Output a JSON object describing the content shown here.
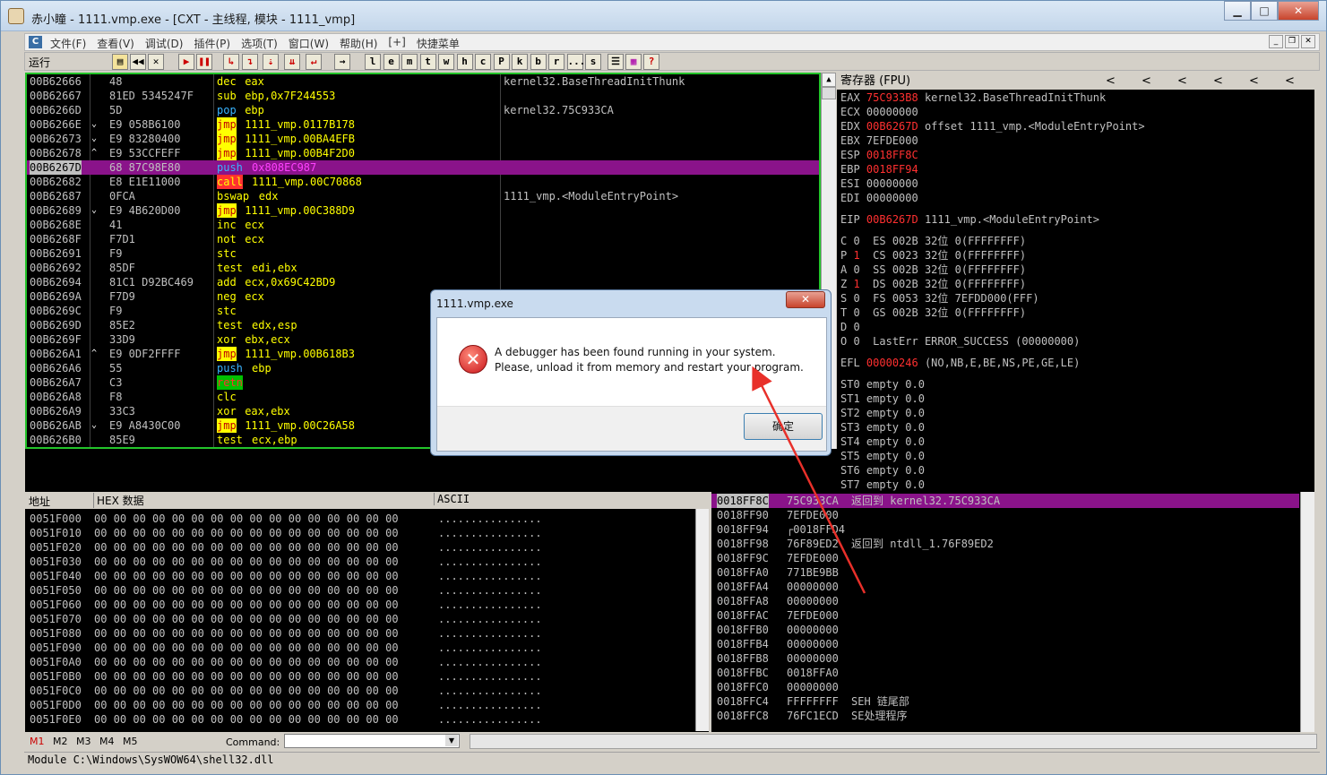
{
  "window": {
    "title": "赤小瞳 - 1111.vmp.exe - [CXT - 主线程, 模块 - 1111_vmp]",
    "min": "▁",
    "max": "□",
    "close": "✕"
  },
  "menu": {
    "logo": "C",
    "items": [
      "文件(F)",
      "查看(V)",
      "调试(D)",
      "插件(P)",
      "选项(T)",
      "窗口(W)",
      "帮助(H)",
      "[+]",
      "快捷菜单"
    ]
  },
  "toolbar": {
    "status": "运行",
    "letters": [
      "l",
      "e",
      "m",
      "t",
      "w",
      "h",
      "c",
      "P",
      "k",
      "b",
      "r",
      "...",
      "s"
    ]
  },
  "cpu_rows": [
    {
      "addr": "00B62666",
      "mark": "",
      "hex": "48",
      "mnem": "dec",
      "opnd": "eax",
      "cmt": "kernel32.BaseThreadInitThunk",
      "mc": "",
      "oc": ""
    },
    {
      "addr": "00B62667",
      "mark": "",
      "hex": "81ED 5345247F",
      "mnem": "sub",
      "opnd": "ebp,0x7F244553",
      "cmt": "",
      "mc": "",
      "oc": ""
    },
    {
      "addr": "00B6266D",
      "mark": "",
      "hex": "5D",
      "mnem": "pop",
      "opnd": "ebp",
      "cmt": "kernel32.75C933CA",
      "mc": "blu",
      "oc": ""
    },
    {
      "addr": "00B6266E",
      "mark": "⌄",
      "hex": "E9 058B6100",
      "mnem": "jmp",
      "opnd": "1111_vmp.0117B178",
      "cmt": "",
      "mc": "jmp",
      "oc": ""
    },
    {
      "addr": "00B62673",
      "mark": "⌄",
      "hex": "E9 83280400",
      "mnem": "jmp",
      "opnd": "1111_vmp.00BA4EFB",
      "cmt": "",
      "mc": "jmp",
      "oc": ""
    },
    {
      "addr": "00B62678",
      "mark": "^",
      "hex": "E9 53CCFEFF",
      "mnem": "jmp",
      "opnd": "1111_vmp.00B4F2D0",
      "cmt": "",
      "mc": "jmp",
      "oc": ""
    },
    {
      "addr": "00B6267D",
      "mark": "",
      "hex": "68 87C98E80",
      "mnem": "push",
      "opnd": "0x808EC987",
      "cmt": "",
      "mc": "blu",
      "oc": "fill",
      "sel": true
    },
    {
      "addr": "00B62682",
      "mark": "",
      "hex": "E8 E1E11000",
      "mnem": "call",
      "opnd": "1111_vmp.00C70868",
      "cmt": "",
      "mc": "call",
      "oc": ""
    },
    {
      "addr": "00B62687",
      "mark": "",
      "hex": "0FCA",
      "mnem": "bswap",
      "opnd": "edx",
      "cmt": "1111_vmp.<ModuleEntryPoint>",
      "mc": "",
      "oc": ""
    },
    {
      "addr": "00B62689",
      "mark": "⌄",
      "hex": "E9 4B620D00",
      "mnem": "jmp",
      "opnd": "1111_vmp.00C388D9",
      "cmt": "",
      "mc": "jmp",
      "oc": ""
    },
    {
      "addr": "00B6268E",
      "mark": "",
      "hex": "41",
      "mnem": "inc",
      "opnd": "ecx",
      "cmt": "",
      "mc": "",
      "oc": ""
    },
    {
      "addr": "00B6268F",
      "mark": "",
      "hex": "F7D1",
      "mnem": "not",
      "opnd": "ecx",
      "cmt": "",
      "mc": "",
      "oc": ""
    },
    {
      "addr": "00B62691",
      "mark": "",
      "hex": "F9",
      "mnem": "stc",
      "opnd": "",
      "cmt": "",
      "mc": "",
      "oc": ""
    },
    {
      "addr": "00B62692",
      "mark": "",
      "hex": "85DF",
      "mnem": "test",
      "opnd": "edi,ebx",
      "cmt": "",
      "mc": "",
      "oc": ""
    },
    {
      "addr": "00B62694",
      "mark": "",
      "hex": "81C1 D92BC469",
      "mnem": "add",
      "opnd": "ecx,0x69C42BD9",
      "cmt": "",
      "mc": "",
      "oc": ""
    },
    {
      "addr": "00B6269A",
      "mark": "",
      "hex": "F7D9",
      "mnem": "neg",
      "opnd": "ecx",
      "cmt": "",
      "mc": "",
      "oc": ""
    },
    {
      "addr": "00B6269C",
      "mark": "",
      "hex": "F9",
      "mnem": "stc",
      "opnd": "",
      "cmt": "",
      "mc": "",
      "oc": ""
    },
    {
      "addr": "00B6269D",
      "mark": "",
      "hex": "85E2",
      "mnem": "test",
      "opnd": "edx,esp",
      "cmt": "",
      "mc": "",
      "oc": ""
    },
    {
      "addr": "00B6269F",
      "mark": "",
      "hex": "33D9",
      "mnem": "xor",
      "opnd": "ebx,ecx",
      "cmt": "",
      "mc": "",
      "oc": ""
    },
    {
      "addr": "00B626A1",
      "mark": "^",
      "hex": "E9 0DF2FFFF",
      "mnem": "jmp",
      "opnd": "1111_vmp.00B618B3",
      "cmt": "",
      "mc": "jmp",
      "oc": ""
    },
    {
      "addr": "00B626A6",
      "mark": "",
      "hex": "55",
      "mnem": "push",
      "opnd": "ebp",
      "cmt": "",
      "mc": "blu",
      "oc": ""
    },
    {
      "addr": "00B626A7",
      "mark": "",
      "hex": "C3",
      "mnem": "retn",
      "opnd": "",
      "cmt": "",
      "mc": "retn",
      "oc": ""
    },
    {
      "addr": "00B626A8",
      "mark": "",
      "hex": "F8",
      "mnem": "clc",
      "opnd": "",
      "cmt": "",
      "mc": "",
      "oc": ""
    },
    {
      "addr": "00B626A9",
      "mark": "",
      "hex": "33C3",
      "mnem": "xor",
      "opnd": "eax,ebx",
      "cmt": "",
      "mc": "",
      "oc": ""
    },
    {
      "addr": "00B626AB",
      "mark": "⌄",
      "hex": "E9 A8430C00",
      "mnem": "jmp",
      "opnd": "1111_vmp.00C26A58",
      "cmt": "",
      "mc": "jmp",
      "oc": ""
    },
    {
      "addr": "00B626B0",
      "mark": "",
      "hex": "85E9",
      "mnem": "test",
      "opnd": "ecx,ebp",
      "cmt": "",
      "mc": "",
      "oc": ""
    }
  ],
  "registers": {
    "header": "寄存器 (FPU)",
    "lines": [
      {
        "name": "EAX",
        "val": "75C933B8",
        "red": true,
        "rest": " kernel32.BaseThreadInitThunk",
        "gap": 0
      },
      {
        "name": "ECX",
        "val": "00000000",
        "red": false,
        "rest": "",
        "gap": 0
      },
      {
        "name": "EDX",
        "val": "00B6267D",
        "red": true,
        "rest": " offset 1111_vmp.<ModuleEntryPoint>",
        "gap": 0
      },
      {
        "name": "EBX",
        "val": "7EFDE000",
        "red": false,
        "rest": "",
        "gap": 0
      },
      {
        "name": "ESP",
        "val": "0018FF8C",
        "red": true,
        "rest": "",
        "gap": 0
      },
      {
        "name": "EBP",
        "val": "0018FF94",
        "red": true,
        "rest": "",
        "gap": 0
      },
      {
        "name": "ESI",
        "val": "00000000",
        "red": false,
        "rest": "",
        "gap": 0
      },
      {
        "name": "EDI",
        "val": "00000000",
        "red": false,
        "rest": "",
        "gap": 0
      },
      {
        "name": "EIP",
        "val": "00B6267D",
        "red": true,
        "rest": " 1111_vmp.<ModuleEntryPoint>",
        "gap": 1
      }
    ],
    "flags": [
      {
        "f": "C",
        "v": "0",
        "red": false,
        "seg": "  ES 002B 32位 0(FFFFFFFF)"
      },
      {
        "f": "P",
        "v": "1",
        "red": true,
        "seg": "  CS 0023 32位 0(FFFFFFFF)"
      },
      {
        "f": "A",
        "v": "0",
        "red": false,
        "seg": "  SS 002B 32位 0(FFFFFFFF)"
      },
      {
        "f": "Z",
        "v": "1",
        "red": true,
        "seg": "  DS 002B 32位 0(FFFFFFFF)"
      },
      {
        "f": "S",
        "v": "0",
        "red": false,
        "seg": "  FS 0053 32位 7EFDD000(FFF)"
      },
      {
        "f": "T",
        "v": "0",
        "red": false,
        "seg": "  GS 002B 32位 0(FFFFFFFF)"
      },
      {
        "f": "D",
        "v": "0",
        "red": false,
        "seg": ""
      },
      {
        "f": "O",
        "v": "0",
        "red": false,
        "seg": "  LastErr ERROR_SUCCESS (00000000)"
      }
    ],
    "efl": {
      "name": "EFL",
      "val": "00000246",
      "rest": " (NO,NB,E,BE,NS,PE,GE,LE)"
    },
    "st": [
      "ST0 empty 0.0",
      "ST1 empty 0.0",
      "ST2 empty 0.0",
      "ST3 empty 0.0",
      "ST4 empty 0.0",
      "ST5 empty 0.0",
      "ST6 empty 0.0",
      "ST7 empty 0.0"
    ]
  },
  "dump": {
    "col_addr": "地址",
    "col_hex": "HEX 数据",
    "col_ascii": "ASCII",
    "rows": [
      "0051F000",
      "0051F010",
      "0051F020",
      "0051F030",
      "0051F040",
      "0051F050",
      "0051F060",
      "0051F070",
      "0051F080",
      "0051F090",
      "0051F0A0",
      "0051F0B0",
      "0051F0C0",
      "0051F0D0",
      "0051F0E0"
    ],
    "hex": "00 00 00 00 00 00 00 00 00 00 00 00 00 00 00 00",
    "ascii": "................"
  },
  "stack": [
    {
      "a": "0018FF8C",
      "v": "75C933CA",
      "c": "返回到 kernel32.75C933CA",
      "sel": true
    },
    {
      "a": "0018FF90",
      "v": "7EFDE000",
      "c": ""
    },
    {
      "a": "0018FF94",
      "v": "┌0018FFD4",
      "c": ""
    },
    {
      "a": "0018FF98",
      "v": "76F89ED2",
      "c": "返回到 ntdll_1.76F89ED2"
    },
    {
      "a": "0018FF9C",
      "v": "7EFDE000",
      "c": ""
    },
    {
      "a": "0018FFA0",
      "v": "771BE9BB",
      "c": ""
    },
    {
      "a": "0018FFA4",
      "v": "00000000",
      "c": ""
    },
    {
      "a": "0018FFA8",
      "v": "00000000",
      "c": ""
    },
    {
      "a": "0018FFAC",
      "v": "7EFDE000",
      "c": ""
    },
    {
      "a": "0018FFB0",
      "v": "00000000",
      "c": ""
    },
    {
      "a": "0018FFB4",
      "v": "00000000",
      "c": ""
    },
    {
      "a": "0018FFB8",
      "v": "00000000",
      "c": ""
    },
    {
      "a": "0018FFBC",
      "v": "0018FFA0",
      "c": ""
    },
    {
      "a": "0018FFC0",
      "v": "00000000",
      "c": ""
    },
    {
      "a": "0018FFC4",
      "v": "FFFFFFFF",
      "c": "SEH 链尾部"
    },
    {
      "a": "0018FFC8",
      "v": "76FC1ECD",
      "c": "SE处理程序"
    }
  ],
  "bottom": {
    "tabs": [
      "M1",
      "M2",
      "M3",
      "M4",
      "M5"
    ],
    "command_label": "Command:",
    "status": "Module C:\\Windows\\SysWOW64\\shell32.dll"
  },
  "dialog": {
    "title": "1111.vmp.exe",
    "line1": "A debugger has been found running in your system.",
    "line2": "Please, unload it from memory and restart your program.",
    "ok": "确定",
    "close": "✕"
  },
  "colors": {
    "selection": "#8a138a",
    "jmp_bg": "#ffff00",
    "red_text": "#ff3030",
    "border_green": "#23c42a",
    "arrow": "#e8302a"
  }
}
